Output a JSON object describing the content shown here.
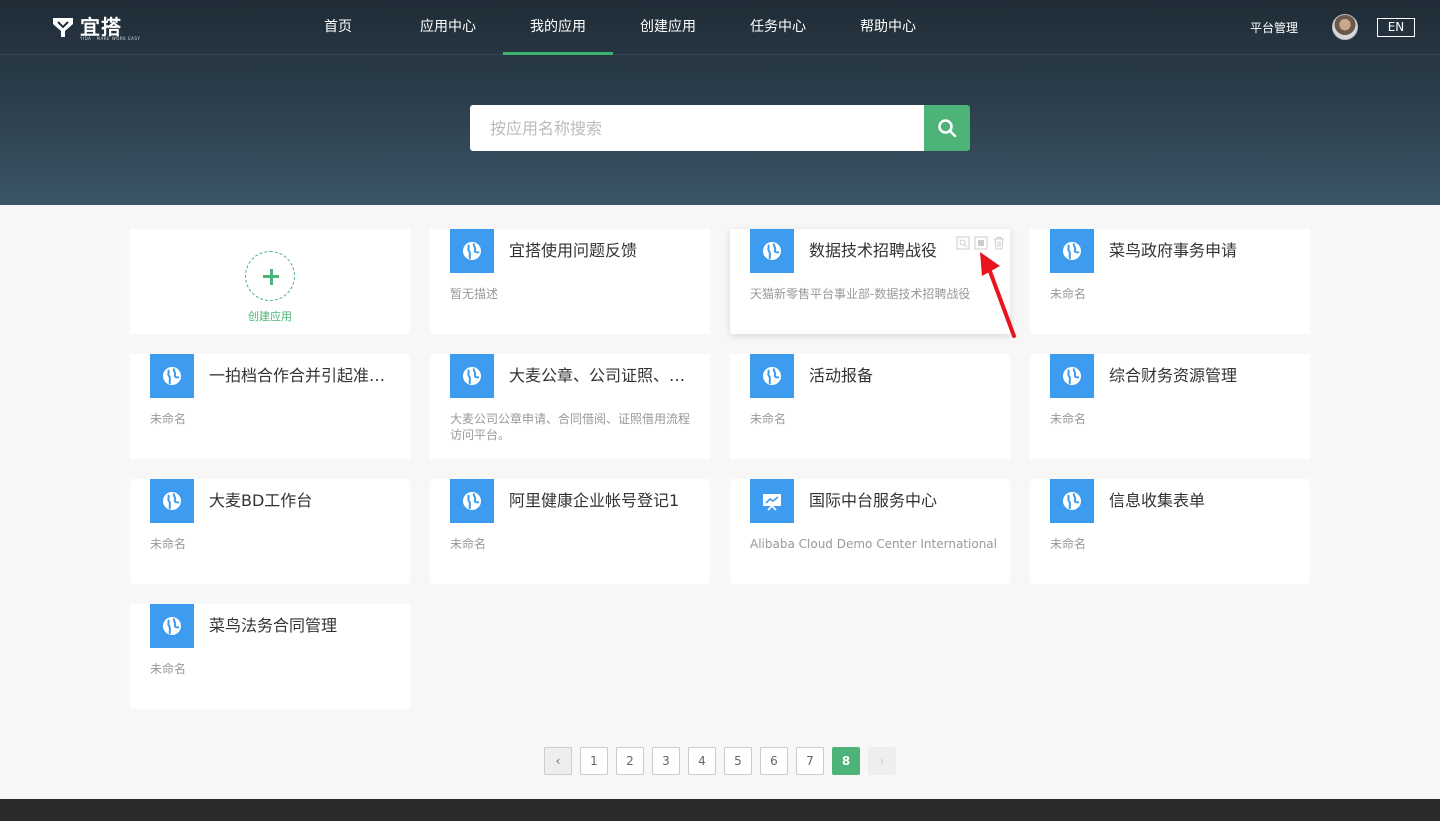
{
  "brand": {
    "name": "宜搭",
    "subtitle": "YIDA · MAKE WORK EASY"
  },
  "nav": [
    "首页",
    "应用中心",
    "我的应用",
    "创建应用",
    "任务中心",
    "帮助中心"
  ],
  "nav_active_index": 2,
  "topbar": {
    "platform_label": "平台管理",
    "lang_label": "EN"
  },
  "search": {
    "placeholder": "按应用名称搜索",
    "value": ""
  },
  "create": {
    "label": "创建应用"
  },
  "apps": [
    {
      "title": "宜搭使用问题反馈",
      "desc": "暂无描述",
      "icon": "globe-icon"
    },
    {
      "title": "数据技术招聘战役",
      "desc": "天猫新零售平台事业部-数据技术招聘战役",
      "icon": "globe-icon",
      "hover": true
    },
    {
      "title": "菜鸟政府事务申请",
      "desc": "未命名",
      "icon": "globe-icon"
    },
    {
      "title": "一拍档合作合并引起准…",
      "desc": "未命名",
      "icon": "globe-icon"
    },
    {
      "title": "大麦公章、公司证照、…",
      "desc": "大麦公司公章申请、合同借阅、证照借用流程访问平台。",
      "icon": "globe-icon"
    },
    {
      "title": "活动报备",
      "desc": "未命名",
      "icon": "globe-icon"
    },
    {
      "title": "综合财务资源管理",
      "desc": "未命名",
      "icon": "globe-icon"
    },
    {
      "title": "大麦BD工作台",
      "desc": "未命名",
      "icon": "globe-icon"
    },
    {
      "title": "阿里健康企业帐号登记1",
      "desc": "未命名",
      "icon": "globe-icon"
    },
    {
      "title": "国际中台服务中心",
      "desc": "Alibaba Cloud Demo Center International",
      "icon": "presentation-icon"
    },
    {
      "title": "信息收集表单",
      "desc": "未命名",
      "icon": "globe-icon"
    },
    {
      "title": "菜鸟法务合同管理",
      "desc": "未命名",
      "icon": "globe-icon"
    }
  ],
  "pagination": {
    "pages": [
      "1",
      "2",
      "3",
      "4",
      "5",
      "6",
      "7",
      "8"
    ],
    "current": "8",
    "prev": "‹",
    "next": "›"
  },
  "colors": {
    "accent": "#4db379",
    "icon_bg": "#3d9cf0",
    "header_dark": "#1f2c36",
    "annotation_arrow": "#e8141e"
  }
}
